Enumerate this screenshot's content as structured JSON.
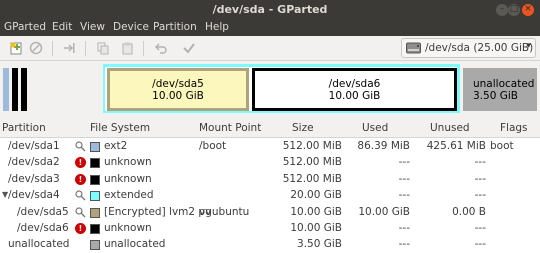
{
  "window": {
    "title": "/dev/sda - GParted"
  },
  "menu": [
    "GParted",
    "Edit",
    "View",
    "Device",
    "Partition",
    "Help"
  ],
  "device": {
    "label": "/dev/sda  (25.00 GiB)"
  },
  "map": {
    "sda5": {
      "name": "/dev/sda5",
      "size": "10.00 GiB"
    },
    "sda6": {
      "name": "/dev/sda6",
      "size": "10.00 GiB"
    },
    "unalloc": {
      "name": "unallocated",
      "size": "3.50 GiB"
    }
  },
  "columns": [
    "Partition",
    "File System",
    "Mount Point",
    "Size",
    "Used",
    "Unused",
    "Flags"
  ],
  "rows": [
    {
      "partition": "/dev/sda1",
      "fs": "ext2",
      "mount": "/boot",
      "size": "512.00 MiB",
      "used": "86.39 MiB",
      "unused": "425.61 MiB",
      "flags": "boot",
      "color": "#9dbadb",
      "mark": "lock"
    },
    {
      "partition": "/dev/sda2",
      "fs": "unknown",
      "mount": "",
      "size": "512.00 MiB",
      "used": "---",
      "unused": "---",
      "flags": "",
      "color": "#000000",
      "mark": "warn"
    },
    {
      "partition": "/dev/sda3",
      "fs": "unknown",
      "mount": "",
      "size": "512.00 MiB",
      "used": "---",
      "unused": "---",
      "flags": "",
      "color": "#000000",
      "mark": "warn"
    },
    {
      "partition": "/dev/sda4",
      "fs": "extended",
      "mount": "",
      "size": "20.00 GiB",
      "used": "---",
      "unused": "---",
      "flags": "",
      "color": "#7dfcfe",
      "mark": "lock"
    },
    {
      "partition": "/dev/sda5",
      "fs": "[Encrypted] lvm2 pv",
      "mount": "vgubuntu",
      "size": "10.00 GiB",
      "used": "10.00 GiB",
      "unused": "0.00 B",
      "flags": "",
      "color": "#b0a27c",
      "mark": "lock"
    },
    {
      "partition": "/dev/sda6",
      "fs": "unknown",
      "mount": "",
      "size": "10.00 GiB",
      "used": "---",
      "unused": "---",
      "flags": "",
      "color": "#000000",
      "mark": "warn"
    },
    {
      "partition": "unallocated",
      "fs": "unallocated",
      "mount": "",
      "size": "3.50 GiB",
      "used": "---",
      "unused": "---",
      "flags": "",
      "color": "#a9a9a9",
      "mark": ""
    }
  ],
  "colors": {
    "ext2": "#9dbadb",
    "extended": "#7dfcfe",
    "lvm2": "#fbf7bd",
    "unknown": "#000000",
    "unallocated": "#a9a9a9",
    "warning": "#cc0000",
    "accent": "#e95420"
  }
}
